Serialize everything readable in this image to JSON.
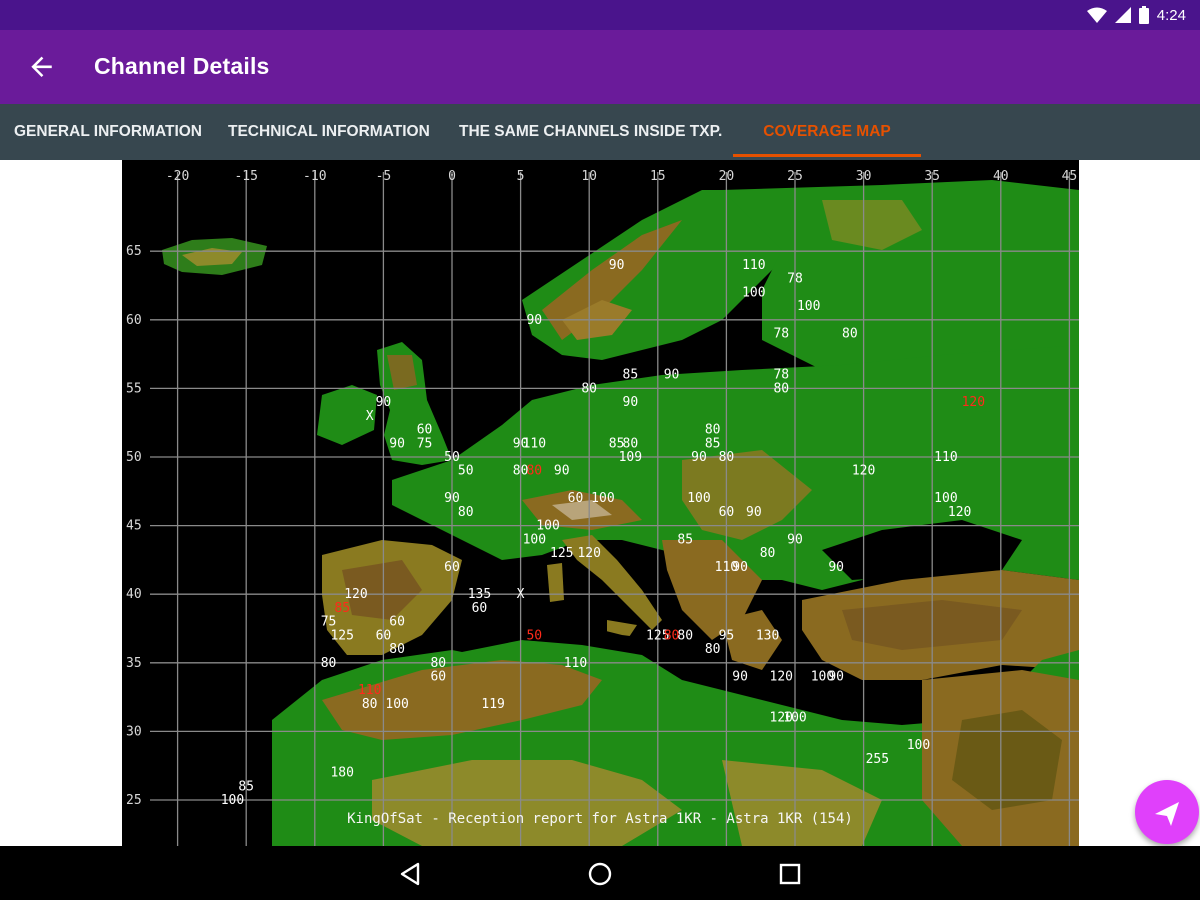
{
  "status_bar": {
    "time": "4:24"
  },
  "app_bar": {
    "title": "Channel Details",
    "back_icon": "arrow-back-icon"
  },
  "tabs": [
    {
      "label": "GENERAL INFORMATION",
      "active": false
    },
    {
      "label": "TECHNICAL INFORMATION",
      "active": false
    },
    {
      "label": "THE SAME CHANNELS INSIDE TXP.",
      "active": false
    },
    {
      "label": "COVERAGE MAP",
      "active": true
    }
  ],
  "colors": {
    "status_bar": "#4a148c",
    "app_bar": "#6a1b9a",
    "tab_bar": "#37474f",
    "accent": "#e65100",
    "fab": "#e040fb"
  },
  "map": {
    "caption": "KingOfSat - Reception report for Astra 1KR - Astra 1KR (154)",
    "longitude_labels": [
      "-20",
      "-15",
      "-10",
      "-5",
      "0",
      "5",
      "10",
      "15",
      "20",
      "25",
      "30",
      "35",
      "40",
      "45"
    ],
    "latitude_labels": [
      "65",
      "60",
      "55",
      "50",
      "45",
      "40",
      "35",
      "30",
      "25"
    ],
    "reports": [
      {
        "lon": 12,
        "lat": 64,
        "value": "90"
      },
      {
        "lon": 22,
        "lat": 64,
        "value": "110"
      },
      {
        "lon": 25,
        "lat": 63,
        "value": "78"
      },
      {
        "lon": 6,
        "lat": 60,
        "value": "90"
      },
      {
        "lon": 22,
        "lat": 62,
        "value": "100"
      },
      {
        "lon": 26,
        "lat": 61,
        "value": "100"
      },
      {
        "lon": 24,
        "lat": 59,
        "value": "78"
      },
      {
        "lon": 29,
        "lat": 59,
        "value": "80"
      },
      {
        "lon": 13,
        "lat": 56,
        "value": "85"
      },
      {
        "lon": 16,
        "lat": 56,
        "value": "90"
      },
      {
        "lon": 24,
        "lat": 56,
        "value": "78"
      },
      {
        "lon": 24,
        "lat": 55,
        "value": "80"
      },
      {
        "lon": 10,
        "lat": 55,
        "value": "80"
      },
      {
        "lon": 13,
        "lat": 54,
        "value": "90"
      },
      {
        "lon": -5,
        "lat": 54,
        "value": "90"
      },
      {
        "lon": 38,
        "lat": 54,
        "value": "120",
        "red": true
      },
      {
        "lon": -2,
        "lat": 52,
        "value": "60"
      },
      {
        "lon": -4,
        "lat": 51,
        "value": "90"
      },
      {
        "lon": -2,
        "lat": 51,
        "value": "75"
      },
      {
        "lon": 0,
        "lat": 50,
        "value": "50"
      },
      {
        "lon": 1,
        "lat": 49,
        "value": "50"
      },
      {
        "lon": 5,
        "lat": 51,
        "value": "90"
      },
      {
        "lon": 6,
        "lat": 51,
        "value": "110"
      },
      {
        "lon": 12,
        "lat": 51,
        "value": "85"
      },
      {
        "lon": 13,
        "lat": 51,
        "value": "80"
      },
      {
        "lon": 13,
        "lat": 50,
        "value": "109"
      },
      {
        "lon": 19,
        "lat": 52,
        "value": "80"
      },
      {
        "lon": 19,
        "lat": 51,
        "value": "85"
      },
      {
        "lon": 18,
        "lat": 50,
        "value": "90"
      },
      {
        "lon": 20,
        "lat": 50,
        "value": "80"
      },
      {
        "lon": 36,
        "lat": 50,
        "value": "110"
      },
      {
        "lon": 5,
        "lat": 49,
        "value": "80"
      },
      {
        "lon": 6,
        "lat": 49,
        "value": "80",
        "red": true
      },
      {
        "lon": 8,
        "lat": 49,
        "value": "90"
      },
      {
        "lon": 30,
        "lat": 49,
        "value": "120"
      },
      {
        "lon": 0,
        "lat": 47,
        "value": "90"
      },
      {
        "lon": 1,
        "lat": 46,
        "value": "80"
      },
      {
        "lon": 9,
        "lat": 47,
        "value": "60"
      },
      {
        "lon": 11,
        "lat": 47,
        "value": "100"
      },
      {
        "lon": 18,
        "lat": 47,
        "value": "100"
      },
      {
        "lon": 20,
        "lat": 46,
        "value": "60"
      },
      {
        "lon": 22,
        "lat": 46,
        "value": "90"
      },
      {
        "lon": 36,
        "lat": 47,
        "value": "100"
      },
      {
        "lon": 37,
        "lat": 46,
        "value": "120"
      },
      {
        "lon": 7,
        "lat": 45,
        "value": "100"
      },
      {
        "lon": 6,
        "lat": 44,
        "value": "100"
      },
      {
        "lon": 8,
        "lat": 43,
        "value": "125"
      },
      {
        "lon": 10,
        "lat": 43,
        "value": "120"
      },
      {
        "lon": 17,
        "lat": 44,
        "value": "85"
      },
      {
        "lon": 20,
        "lat": 42,
        "value": "110"
      },
      {
        "lon": 21,
        "lat": 42,
        "value": "90"
      },
      {
        "lon": 23,
        "lat": 43,
        "value": "80"
      },
      {
        "lon": 25,
        "lat": 44,
        "value": "90"
      },
      {
        "lon": 28,
        "lat": 42,
        "value": "90"
      },
      {
        "lon": 0,
        "lat": 42,
        "value": "60"
      },
      {
        "lon": -7,
        "lat": 40,
        "value": "120"
      },
      {
        "lon": -8,
        "lat": 39,
        "value": "85",
        "red": true
      },
      {
        "lon": -9,
        "lat": 38,
        "value": "75"
      },
      {
        "lon": -8,
        "lat": 37,
        "value": "125"
      },
      {
        "lon": 2,
        "lat": 40,
        "value": "135"
      },
      {
        "lon": 2,
        "lat": 39,
        "value": "60"
      },
      {
        "lon": 6,
        "lat": 37,
        "value": "50",
        "red": true
      },
      {
        "lon": -4,
        "lat": 38,
        "value": "60"
      },
      {
        "lon": -5,
        "lat": 37,
        "value": "60"
      },
      {
        "lon": -4,
        "lat": 36,
        "value": "80"
      },
      {
        "lon": -9,
        "lat": 35,
        "value": "80"
      },
      {
        "lon": -1,
        "lat": 35,
        "value": "80"
      },
      {
        "lon": -1,
        "lat": 34,
        "value": "60"
      },
      {
        "lon": -6,
        "lat": 33,
        "value": "110",
        "red": true
      },
      {
        "lon": -6,
        "lat": 32,
        "value": "80"
      },
      {
        "lon": -4,
        "lat": 32,
        "value": "100"
      },
      {
        "lon": 15,
        "lat": 37,
        "value": "125"
      },
      {
        "lon": 16,
        "lat": 37,
        "value": "80",
        "red": true
      },
      {
        "lon": 17,
        "lat": 37,
        "value": "80"
      },
      {
        "lon": 19,
        "lat": 36,
        "value": "80"
      },
      {
        "lon": 20,
        "lat": 37,
        "value": "95"
      },
      {
        "lon": 23,
        "lat": 37,
        "value": "130"
      },
      {
        "lon": 9,
        "lat": 35,
        "value": "110"
      },
      {
        "lon": 21,
        "lat": 34,
        "value": "90"
      },
      {
        "lon": 24,
        "lat": 34,
        "value": "120"
      },
      {
        "lon": 27,
        "lat": 34,
        "value": "100"
      },
      {
        "lon": 28,
        "lat": 34,
        "value": "90"
      },
      {
        "lon": 3,
        "lat": 32,
        "value": "119"
      },
      {
        "lon": 24,
        "lat": 31,
        "value": "120"
      },
      {
        "lon": 25,
        "lat": 31,
        "value": "100"
      },
      {
        "lon": 34,
        "lat": 29,
        "value": "100"
      },
      {
        "lon": 31,
        "lat": 28,
        "value": "255"
      },
      {
        "lon": -8,
        "lat": 27,
        "value": "180"
      },
      {
        "lon": -15,
        "lat": 26,
        "value": "85"
      },
      {
        "lon": -16,
        "lat": 25,
        "value": "100"
      }
    ],
    "markers": [
      {
        "lon": -6,
        "lat": 53,
        "label": "X"
      },
      {
        "lon": 5,
        "lat": 40,
        "label": "X"
      }
    ]
  },
  "fab": {
    "icon": "send-icon"
  },
  "nav": {
    "back_icon": "nav-back-icon",
    "home_icon": "nav-home-icon",
    "recents_icon": "nav-recents-icon"
  }
}
